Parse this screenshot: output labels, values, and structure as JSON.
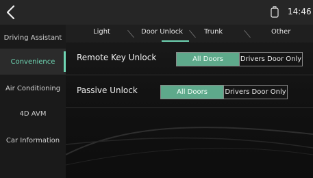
{
  "status_bar": {
    "time": "14:46",
    "back_icon": "chevron-left-icon",
    "battery_icon": "battery-icon"
  },
  "sidebar": {
    "items": [
      {
        "label": "Driving Assistant",
        "active": false
      },
      {
        "label": "Convenience",
        "active": true
      },
      {
        "label": "Air Conditioning",
        "active": false
      },
      {
        "label": "4D AVM",
        "active": false
      },
      {
        "label": "Car Information",
        "active": false
      }
    ]
  },
  "tabs": [
    {
      "label": "Light",
      "active": false
    },
    {
      "label": "Door Unlock",
      "active": true
    },
    {
      "label": "Trunk",
      "active": false
    },
    {
      "label": "Other",
      "active": false
    }
  ],
  "settings": {
    "remote_key_unlock": {
      "label": "Remote Key Unlock",
      "options": [
        "All Doors",
        "Drivers Door Only"
      ],
      "selected": "All Doors"
    },
    "passive_unlock": {
      "label": "Passive Unlock",
      "options": [
        "All Doors",
        "Drivers Door Only"
      ],
      "selected": "All Doors"
    }
  },
  "colors": {
    "accent": "#6fd6b4",
    "selected_fill": "#5ea98b",
    "background": "#141414"
  }
}
